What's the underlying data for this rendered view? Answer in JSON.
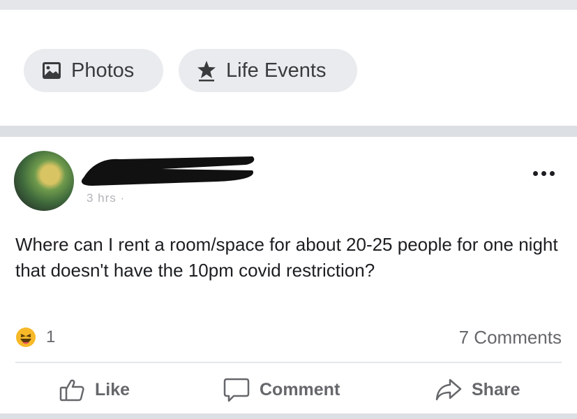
{
  "composer": {
    "photos_label": "Photos",
    "life_events_label": "Life Events",
    "photos_icon": "photo-icon",
    "life_events_icon": "star-icon"
  },
  "post": {
    "author_name_redacted": true,
    "meta": "3 hrs · ",
    "text": "Where can I rent a room/space for about 20-25 people for one night that doesn't have the 10pm covid restriction?",
    "reaction_icon": "haha-emoji-icon",
    "reaction_count": "1",
    "comments_count": "7 Comments",
    "actions": {
      "like": "Like",
      "comment": "Comment",
      "share": "Share"
    }
  },
  "colors": {
    "background": "#f1f2f4",
    "chip": "#e9ebee",
    "text_primary": "#1c1e21",
    "text_secondary": "#65676b",
    "haha_yellow": "#f7b928"
  }
}
